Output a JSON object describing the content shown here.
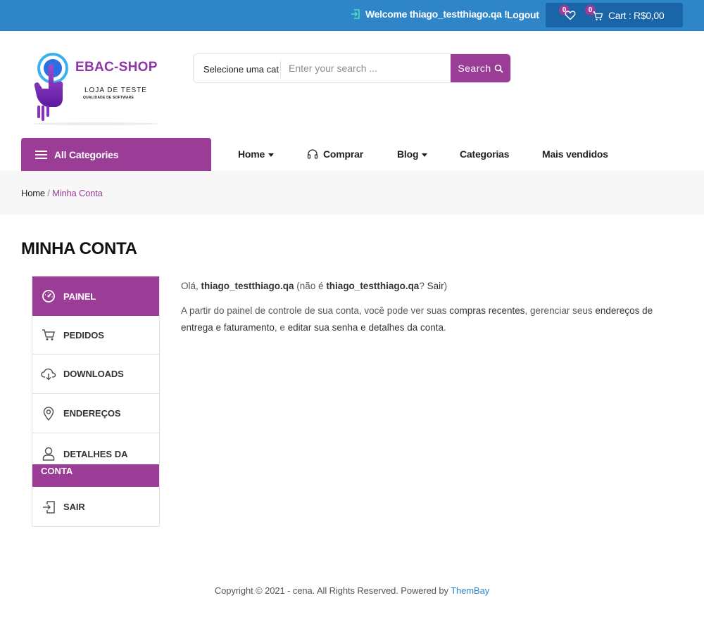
{
  "topbar": {
    "welcome": "Welcome thiago_testthiago.qa !",
    "logout": "Logout",
    "wishlist_count": "0",
    "cart_count": "0",
    "cart_label": "Cart : R$0,00"
  },
  "logo": {
    "title": "EBAC-SHOP",
    "subtitle": "LOJA DE TESTE",
    "tagline": "QUALIDADE DE SOFTWARE"
  },
  "search": {
    "category": "Selecione uma cat",
    "placeholder": "Enter your search ...",
    "button": "Search"
  },
  "nav": {
    "all_categories": "All Categories",
    "items": [
      {
        "label": "Home",
        "dropdown": true
      },
      {
        "label": "Comprar",
        "icon": "headset-icon"
      },
      {
        "label": "Blog",
        "dropdown": true
      },
      {
        "label": "Categorias"
      },
      {
        "label": "Mais vendidos"
      }
    ]
  },
  "breadcrumb": {
    "home": "Home",
    "separator": " / ",
    "current": "Minha Conta"
  },
  "page": {
    "title": "MINHA CONTA"
  },
  "account_nav": [
    {
      "label": "PAINEL",
      "icon": "dashboard-icon",
      "active": true
    },
    {
      "label": "PEDIDOS",
      "icon": "cart-icon"
    },
    {
      "label": "DOWNLOADS",
      "icon": "cloud-download-icon"
    },
    {
      "label": "ENDEREÇOS",
      "icon": "location-pin-icon"
    },
    {
      "label_line1": "DETALHES DA",
      "label_line2": "CONTA",
      "icon": "user-icon"
    },
    {
      "label": "SAIR",
      "icon": "logout-icon"
    }
  ],
  "content": {
    "greeting_prefix": "Olá, ",
    "username": "thiago_testthiago.qa",
    "greeting_middle": " (não é ",
    "username2": "thiago_testthiago.qa",
    "greeting_q": "? ",
    "sair": "Sair",
    "greeting_end": ")",
    "para_prefix": "A partir do painel de controle de sua conta, você pode ver suas ",
    "link_orders": "compras recentes",
    "para_mid1": ", gerenciar seus ",
    "link_addresses": "endereços de entrega e faturamento",
    "para_mid2": ", e ",
    "link_account": "editar sua senha e detalhes da conta",
    "para_end": "."
  },
  "footer": {
    "text": "Copyright © 2021 - cena. All Rights Reserved. Powered by ",
    "brand": "ThemBay"
  },
  "colors": {
    "topbar": "#2e86c9",
    "cartbox": "#1a64a8",
    "accent": "#9b3d97",
    "link": "#2e86c9"
  }
}
